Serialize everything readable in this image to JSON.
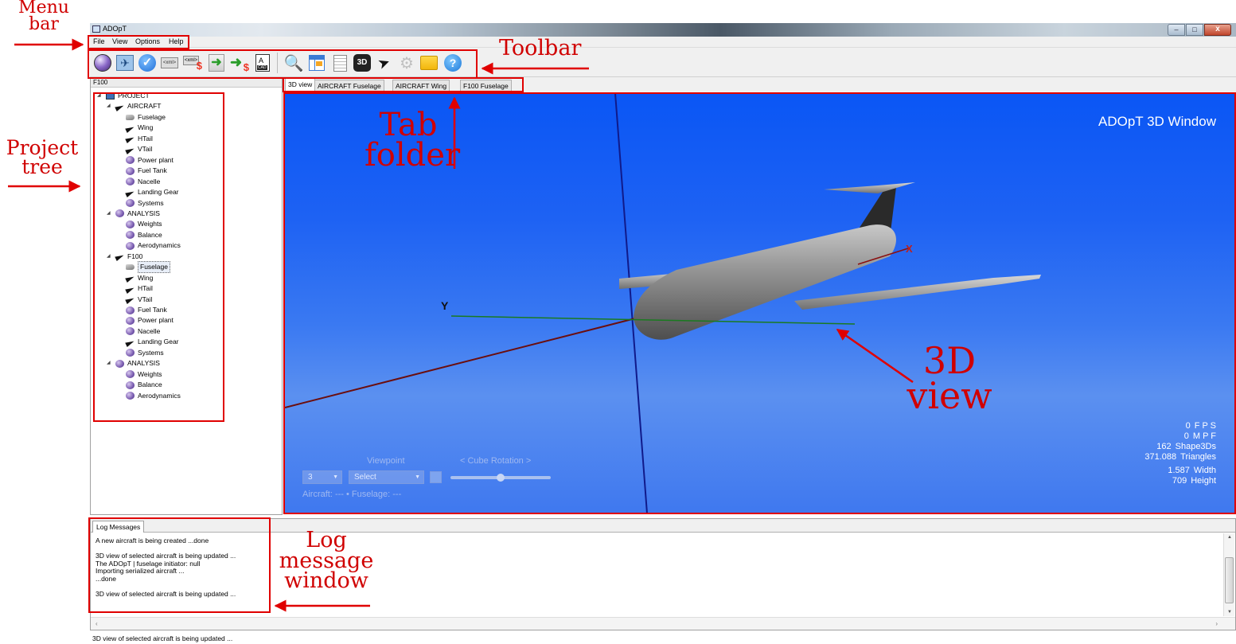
{
  "callouts": {
    "menu_bar": [
      "Menu",
      "bar"
    ],
    "toolbar": "Toolbar",
    "tab_folder": [
      "Tab",
      "folder"
    ],
    "project_tree": [
      "Project",
      "tree"
    ],
    "view_3d": [
      "3D",
      "view"
    ],
    "log_window": [
      "Log",
      "message",
      "window"
    ]
  },
  "colors": {
    "annotation": "#e00000",
    "viewport_top": "#0a56f5",
    "viewport_bottom": "#5b90f0"
  },
  "window": {
    "title": "ADOpT"
  },
  "menu": {
    "items": [
      "File",
      "View",
      "Options",
      "Help"
    ]
  },
  "toolbar": {
    "icons": [
      "new-project-sphere-icon",
      "aircraft-icon",
      "check-icon",
      "xml-icon",
      "xml-export-icon",
      "import-arrow-icon",
      "export-arrow-icon",
      "cad-icon",
      "search-icon",
      "table-icon",
      "document-icon",
      "3d-icon",
      "plane-icon",
      "gear-icon",
      "folder-icon",
      "help-icon"
    ],
    "labels": {
      "xml": "<xml>",
      "cad": "CAD",
      "3d": "3D",
      "help": "?"
    }
  },
  "tree": {
    "header": "F100",
    "nodes": [
      {
        "label": "PROJECT",
        "icon": "project",
        "depth": 0,
        "expander": true
      },
      {
        "label": "AIRCRAFT",
        "icon": "plane",
        "depth": 1,
        "expander": true
      },
      {
        "label": "Fuselage",
        "icon": "fuselage",
        "depth": 2
      },
      {
        "label": "Wing",
        "icon": "plane",
        "depth": 2
      },
      {
        "label": "HTail",
        "icon": "plane",
        "depth": 2
      },
      {
        "label": "VTail",
        "icon": "plane",
        "depth": 2
      },
      {
        "label": "Power plant",
        "icon": "sphere",
        "depth": 2
      },
      {
        "label": "Fuel Tank",
        "icon": "sphere",
        "depth": 2
      },
      {
        "label": "Nacelle",
        "icon": "sphere",
        "depth": 2
      },
      {
        "label": "Landing Gear",
        "icon": "plane",
        "depth": 2
      },
      {
        "label": "Systems",
        "icon": "sphere",
        "depth": 2
      },
      {
        "label": "ANALYSIS",
        "icon": "sphere",
        "depth": 1,
        "expander": true
      },
      {
        "label": "Weights",
        "icon": "sphere",
        "depth": 2
      },
      {
        "label": "Balance",
        "icon": "sphere",
        "depth": 2
      },
      {
        "label": "Aerodynamics",
        "icon": "sphere",
        "depth": 2
      },
      {
        "label": "F100",
        "icon": "plane",
        "depth": 1,
        "expander": true
      },
      {
        "label": "Fuselage",
        "icon": "fuselage",
        "depth": 2,
        "selected": true
      },
      {
        "label": "Wing",
        "icon": "plane",
        "depth": 2
      },
      {
        "label": "HTail",
        "icon": "plane",
        "depth": 2
      },
      {
        "label": "VTail",
        "icon": "plane",
        "depth": 2
      },
      {
        "label": "Fuel Tank",
        "icon": "sphere",
        "depth": 2
      },
      {
        "label": "Power plant",
        "icon": "sphere",
        "depth": 2
      },
      {
        "label": "Nacelle",
        "icon": "sphere",
        "depth": 2
      },
      {
        "label": "Landing Gear",
        "icon": "plane",
        "depth": 2
      },
      {
        "label": "Systems",
        "icon": "sphere",
        "depth": 2
      },
      {
        "label": "ANALYSIS",
        "icon": "sphere",
        "depth": 1,
        "expander": true
      },
      {
        "label": "Weights",
        "icon": "sphere",
        "depth": 2
      },
      {
        "label": "Balance",
        "icon": "sphere",
        "depth": 2
      },
      {
        "label": "Aerodynamics",
        "icon": "sphere",
        "depth": 2
      }
    ]
  },
  "tabs": [
    {
      "label": "3D view",
      "active": true
    },
    {
      "label": "AIRCRAFT Fuselage"
    },
    {
      "label": "AIRCRAFT Wing"
    },
    {
      "label": "F100 Fuselage"
    }
  ],
  "view3d": {
    "title": "ADOpT 3D Window",
    "axis_x": "X",
    "axis_y": "Y",
    "stats": [
      {
        "value": "0",
        "label": "F P S"
      },
      {
        "value": "0",
        "label": "M P F"
      },
      {
        "value": "162",
        "label": "Shape3Ds"
      },
      {
        "value": "371.088",
        "label": "Triangles"
      },
      {
        "value": "1.587",
        "label": "Width"
      },
      {
        "value": "709",
        "label": "Height"
      }
    ],
    "viewpoint_label": "Viewpoint",
    "cube_rotation_label": "< Cube Rotation >",
    "viewpoint_number": "3",
    "viewpoint_select": "Select",
    "cube_rotation_level": 0.5,
    "info_line": "Aircraft: --- • Fuselage: ---"
  },
  "log": {
    "tab": "Log Messages",
    "lines": [
      "A new aircraft is being created ...done",
      "",
      "3D view of selected aircraft is being updated ...",
      "The ADOpT | fuselage initiator: null",
      "Importing serialized aircraft ...",
      "...done",
      "",
      "3D view of selected aircraft is being updated ..."
    ]
  },
  "status": {
    "text": "3D view of selected aircraft is being updated ..."
  }
}
